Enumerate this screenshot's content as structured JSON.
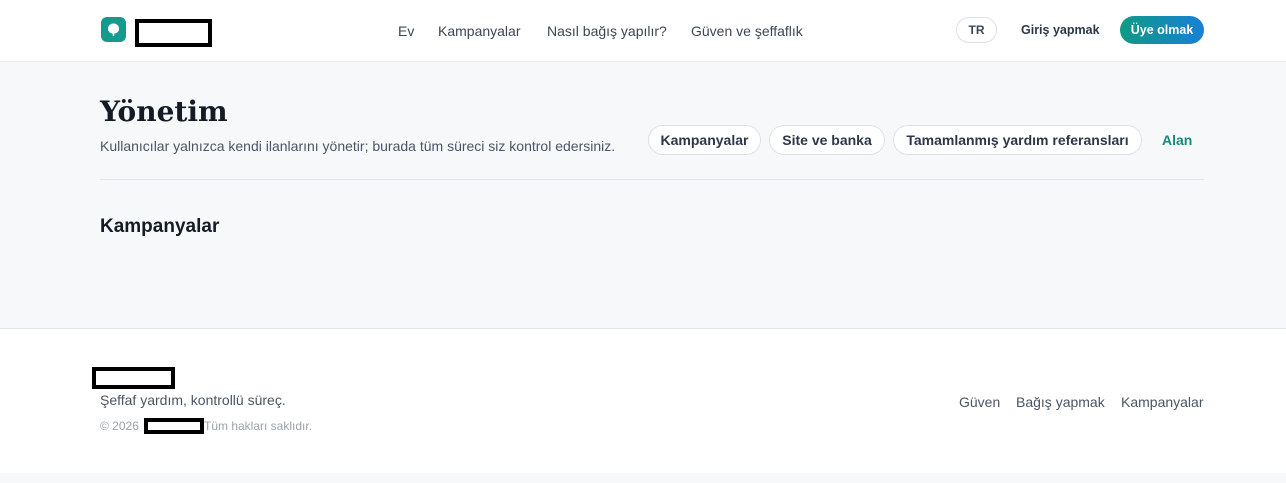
{
  "header": {
    "logo_icon": "leaf-logo-icon",
    "nav": [
      {
        "label": "Ev"
      },
      {
        "label": "Kampanyalar"
      },
      {
        "label": "Nasıl bağış yapılır?"
      },
      {
        "label": "Güven ve şeffaflık"
      }
    ],
    "lang": "TR",
    "login": "Giriş yapmak",
    "signup": "Üye olmak"
  },
  "main": {
    "title": "Yönetim",
    "subtitle": "Kullanıcılar yalnızca kendi ilanlarını yönetir; burada tüm süreci siz kontrol edersiniz.",
    "tabs": [
      {
        "label": "Kampanyalar"
      },
      {
        "label": "Site ve banka"
      },
      {
        "label": "Tamamlanmış yardım referansları"
      }
    ],
    "extra_link": "Alan",
    "section_title": "Kampanyalar"
  },
  "footer": {
    "tagline": "Şeffaf yardım, kontrollü süreç.",
    "copyright_prefix": "© 2026",
    "copyright_suffix": "Tüm hakları saklıdır.",
    "links": [
      {
        "label": "Güven"
      },
      {
        "label": "Bağış yapmak"
      },
      {
        "label": "Kampanyalar"
      }
    ]
  },
  "colors": {
    "accent": "#169a8d",
    "link_accent": "#178a79",
    "signup_gradient_start": "#0e9a86",
    "signup_gradient_end": "#1a7fd6",
    "page_bg": "#f7f8fa"
  }
}
